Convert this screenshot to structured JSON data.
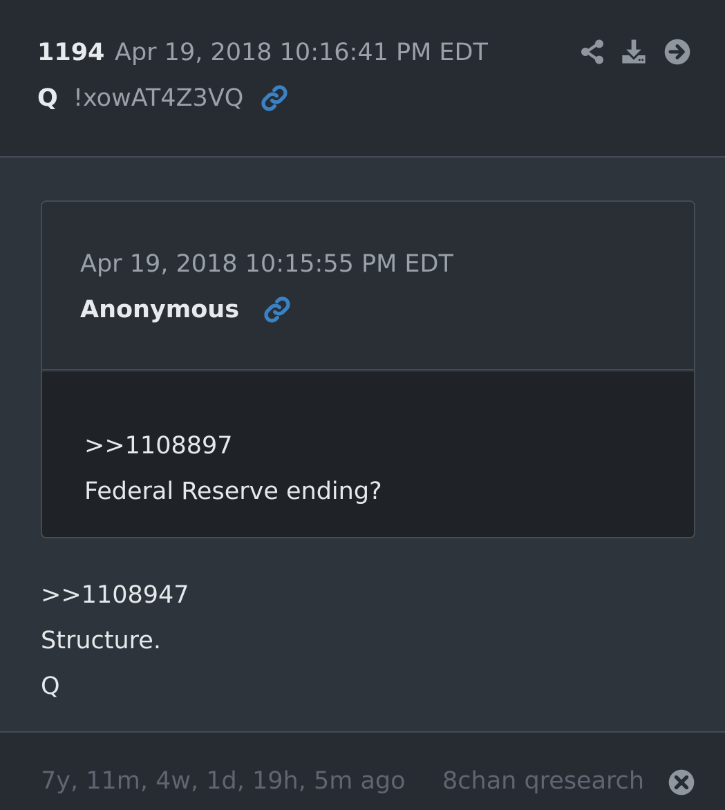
{
  "post": {
    "number": "1194",
    "timestamp": "Apr 19, 2018 10:16:41 PM EDT",
    "author": "Q",
    "tripcode": "!xowAT4Z3VQ",
    "actions": [
      "share-icon",
      "download-icon",
      "arrow-right-circle-icon"
    ],
    "link_icon": "link-icon"
  },
  "quoted": {
    "timestamp": "Apr 19, 2018 10:15:55 PM EDT",
    "author": "Anonymous",
    "lines": [
      ">>1108897",
      "Federal Reserve ending?"
    ]
  },
  "body": {
    "lines": [
      ">>1108947",
      "Structure.",
      "Q"
    ]
  },
  "footer": {
    "age": "7y, 11m, 4w, 1d, 19h, 5m ago",
    "source": "8chan qresearch",
    "close_icon": "close-circle-icon"
  },
  "colors": {
    "background": "#2e343b",
    "header": "#272b32",
    "quote_body": "#1f2226",
    "link_accent": "#3b82c4",
    "muted_text": "#9aa1a9"
  }
}
